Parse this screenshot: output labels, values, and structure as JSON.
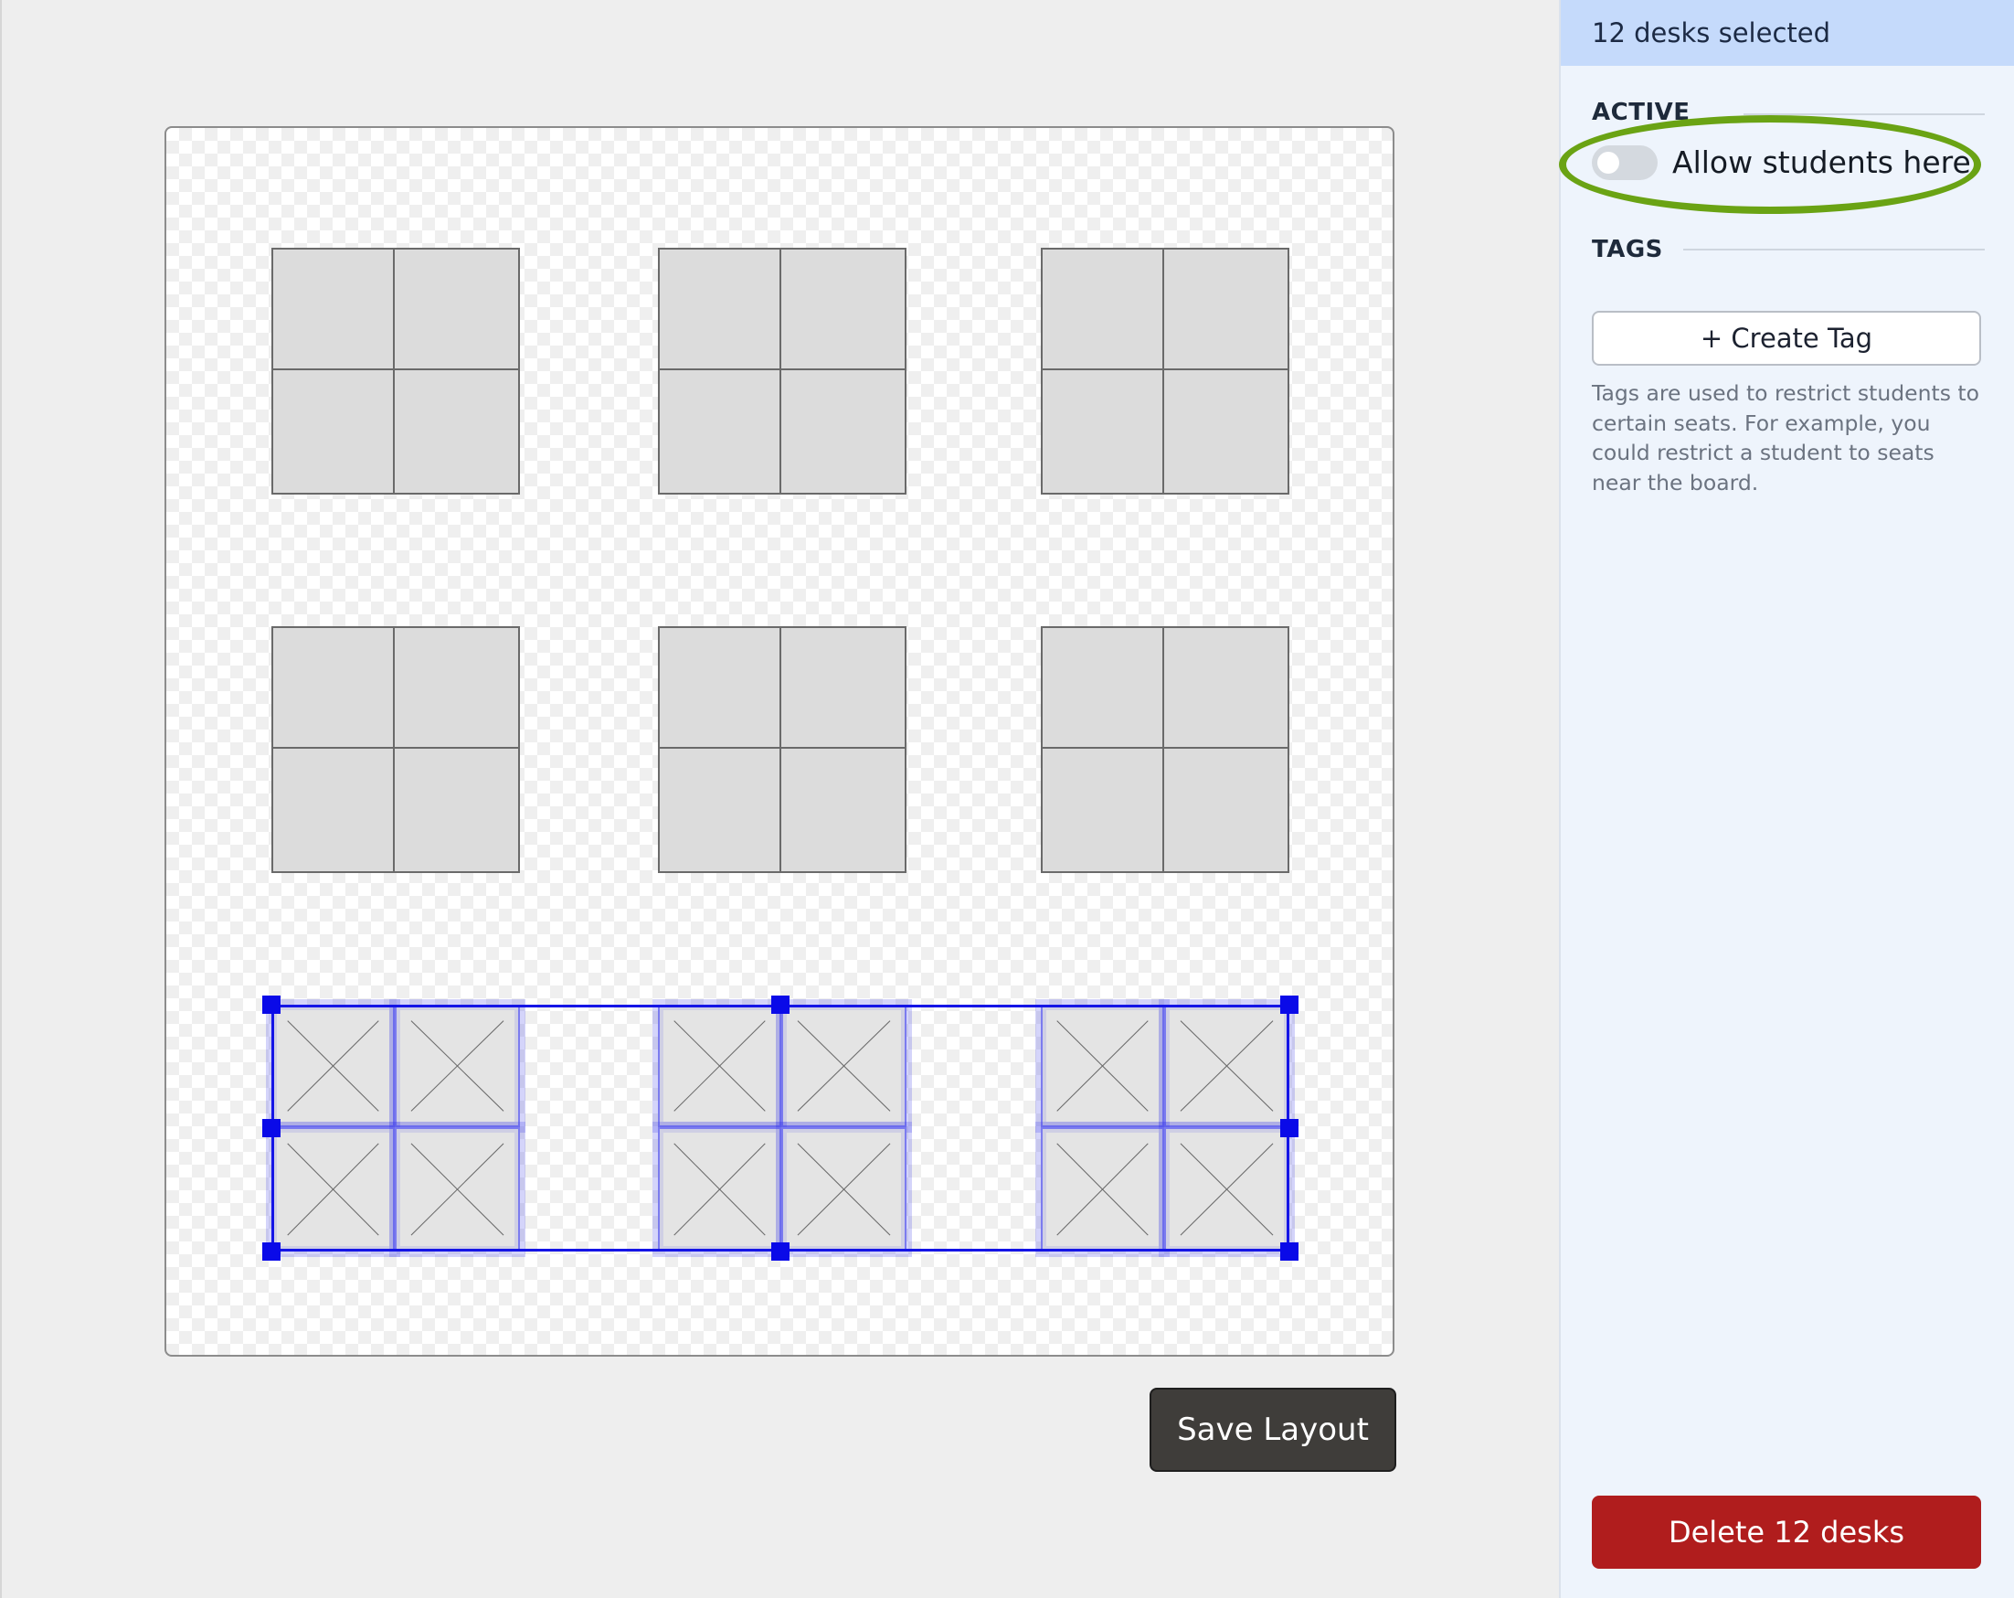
{
  "editor": {
    "save_label": "Save Layout"
  },
  "sidebar": {
    "selection_text": "12 desks selected",
    "active_section": "ACTIVE",
    "toggle_label": "Allow students here",
    "toggle_on": false,
    "tags_section": "TAGS",
    "create_tag_label": "+ Create Tag",
    "tags_help": "Tags are used to restrict students to certain seats. For example, you could restrict a student to seats near the board.",
    "delete_label": "Delete 12 desks"
  },
  "colors": {
    "selection": "#1515e6",
    "highlight_ring": "#6aa314",
    "delete_button": "#b01d1d",
    "save_button": "#3f3d3a",
    "header": "#c5dafb"
  },
  "desk_groups": [
    {
      "row": 1,
      "col": 1,
      "active": true
    },
    {
      "row": 1,
      "col": 2,
      "active": true
    },
    {
      "row": 1,
      "col": 3,
      "active": true
    },
    {
      "row": 2,
      "col": 1,
      "active": true
    },
    {
      "row": 2,
      "col": 2,
      "active": true
    },
    {
      "row": 2,
      "col": 3,
      "active": true
    },
    {
      "row": 3,
      "col": 1,
      "active": false,
      "selected": true
    },
    {
      "row": 3,
      "col": 2,
      "active": false,
      "selected": true
    },
    {
      "row": 3,
      "col": 3,
      "active": false,
      "selected": true
    }
  ]
}
